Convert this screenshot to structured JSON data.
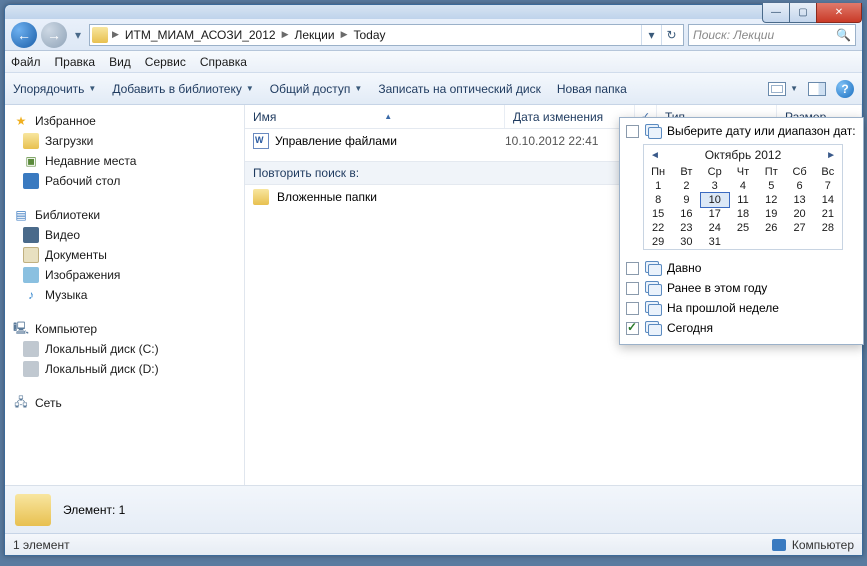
{
  "window_controls": {
    "min": "—",
    "max": "▢",
    "close": "✕"
  },
  "nav": {
    "back": "←",
    "forward": "→",
    "dropdown": "▾"
  },
  "address": {
    "segments": [
      "ИТМ_МИАМ_АСОЗИ_2012",
      "Лекции",
      "Today"
    ],
    "dropdown": "▾",
    "refresh": "↻"
  },
  "search": {
    "placeholder": "Поиск: Лекции",
    "icon": "🔍"
  },
  "menu": [
    "Файл",
    "Правка",
    "Вид",
    "Сервис",
    "Справка"
  ],
  "toolbar": {
    "organize": "Упорядочить",
    "library": "Добавить в библиотеку",
    "share": "Общий доступ",
    "burn": "Записать на оптический диск",
    "newfolder": "Новая папка",
    "help": "?"
  },
  "columns": {
    "name": "Имя",
    "date": "Дата изменения",
    "type": "Тип",
    "size": "Размер",
    "check": "✓"
  },
  "files": [
    {
      "name": "Управление файлами",
      "date": "10.10.2012 22:41"
    }
  ],
  "search_again": {
    "header": "Повторить поиск в:",
    "subfolders": "Вложенные папки"
  },
  "navpane": {
    "favorites": {
      "label": "Избранное",
      "items": [
        "Загрузки",
        "Недавние места",
        "Рабочий стол"
      ]
    },
    "libraries": {
      "label": "Библиотеки",
      "items": [
        "Видео",
        "Документы",
        "Изображения",
        "Музыка"
      ]
    },
    "computer": {
      "label": "Компьютер",
      "items": [
        "Локальный диск (C:)",
        "Локальный диск (D:)"
      ]
    },
    "network": {
      "label": "Сеть"
    }
  },
  "details": {
    "label": "Элемент: 1"
  },
  "status": {
    "left": "1 элемент",
    "right": "Компьютер"
  },
  "datepanel": {
    "title": "Выберите дату или диапазон дат:",
    "month": "Октябрь 2012",
    "prev": "◄",
    "next": "►",
    "dow": [
      "Пн",
      "Вт",
      "Ср",
      "Чт",
      "Пт",
      "Сб",
      "Вс"
    ],
    "days": [
      [
        1,
        2,
        3,
        4,
        5,
        6,
        7
      ],
      [
        8,
        9,
        10,
        11,
        12,
        13,
        14
      ],
      [
        15,
        16,
        17,
        18,
        19,
        20,
        21
      ],
      [
        22,
        23,
        24,
        25,
        26,
        27,
        28
      ],
      [
        29,
        30,
        31
      ]
    ],
    "today": 10,
    "options": [
      {
        "label": "Давно",
        "checked": false
      },
      {
        "label": "Ранее в этом году",
        "checked": false
      },
      {
        "label": "На прошлой неделе",
        "checked": false
      },
      {
        "label": "Сегодня",
        "checked": true
      }
    ]
  }
}
